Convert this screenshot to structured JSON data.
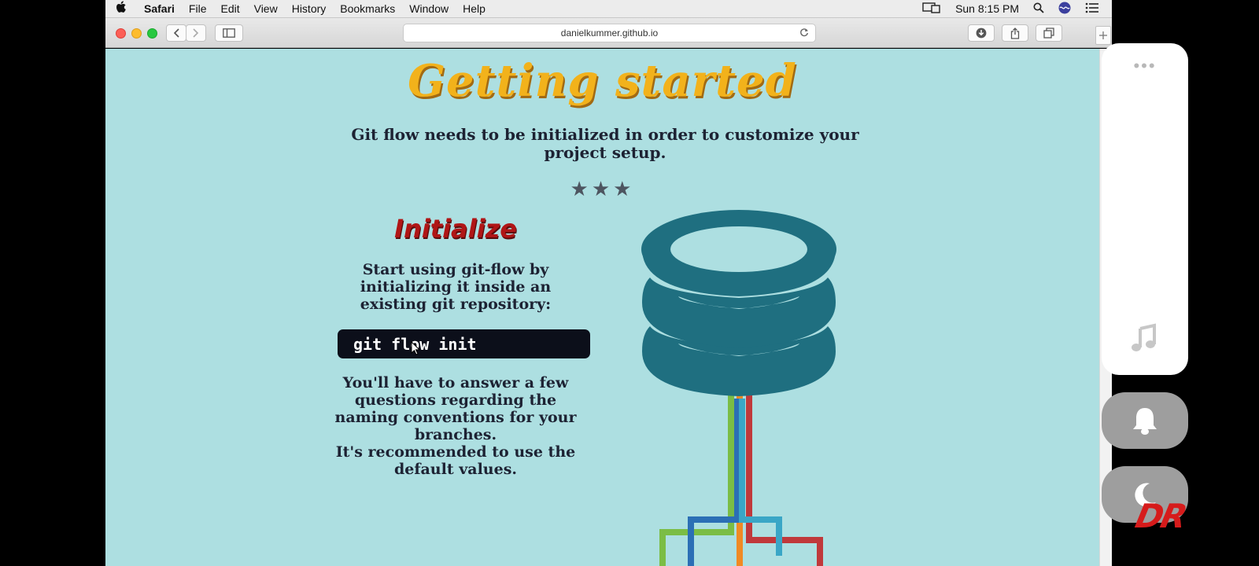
{
  "menubar": {
    "items": [
      "Safari",
      "File",
      "Edit",
      "View",
      "History",
      "Bookmarks",
      "Window",
      "Help"
    ],
    "clock": "Sun 8:15 PM"
  },
  "browser": {
    "url": "danielkummer.github.io"
  },
  "page": {
    "title": "Getting started",
    "intro": "Git flow needs to be initialized in order to customize your project setup.",
    "stars": "★★★",
    "section_title": "Initialize",
    "section_text": "Start using git-flow by initializing it inside an existing git repository:",
    "command": "git flow init",
    "answer_line1": "You'll have to answer a few questions regarding the naming conventions for your branches.",
    "answer_line2": "It's recommended to use the default values."
  },
  "side_panel": {
    "dots": "•••"
  },
  "watermark": "DR",
  "colors": {
    "page_bg": "#addfe1",
    "title_gold": "#f2b21b",
    "section_red": "#b01616",
    "db_teal": "#1f6f80",
    "code_bg": "#0c0f1a"
  }
}
